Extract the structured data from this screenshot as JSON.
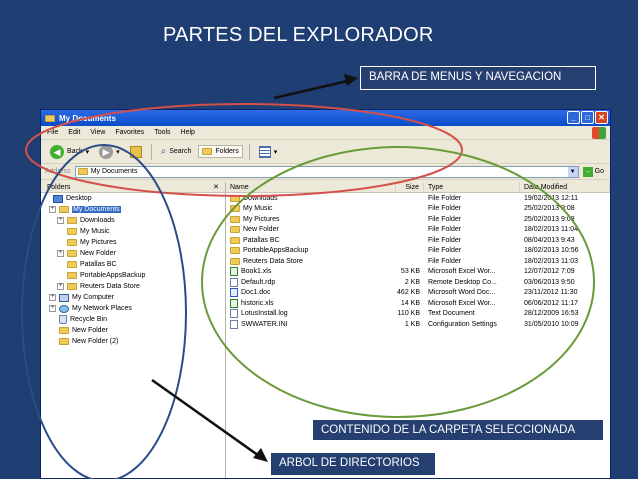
{
  "slide": {
    "title": "PARTES DEL EXPLORADOR",
    "callouts": {
      "menus": "BARRA DE MENUS Y NAVEGACION",
      "content": "CONTENIDO DE LA CARPETA SELECCIONADA",
      "tree": "ARBOL DE DIRECTORIOS"
    }
  },
  "window": {
    "title": "My Documents",
    "menu": [
      "File",
      "Edit",
      "View",
      "Favorites",
      "Tools",
      "Help"
    ],
    "toolbar": {
      "back": "Back",
      "search": "Search",
      "folders": "Folders"
    },
    "address": {
      "label": "Address",
      "value": "My Documents",
      "go": "Go"
    }
  },
  "tree": {
    "header": "Folders",
    "close": "✕",
    "items": [
      {
        "label": "Desktop",
        "icon": "desktop-icon"
      },
      {
        "label": "My Documents",
        "icon": "folder-icon"
      },
      {
        "label": "Downloads",
        "icon": "folder-icon"
      },
      {
        "label": "My Music",
        "icon": "folder-icon"
      },
      {
        "label": "My Pictures",
        "icon": "folder-icon"
      },
      {
        "label": "New Folder",
        "icon": "folder-icon"
      },
      {
        "label": "Patallas BC",
        "icon": "folder-icon"
      },
      {
        "label": "PortableAppsBackup",
        "icon": "folder-icon"
      },
      {
        "label": "Reuters Data Store",
        "icon": "folder-icon"
      },
      {
        "label": "My Computer",
        "icon": "computer-icon"
      },
      {
        "label": "My Network Places",
        "icon": "network-icon"
      },
      {
        "label": "Recycle Bin",
        "icon": "recycle-bin-icon"
      },
      {
        "label": "New Folder",
        "icon": "folder-icon"
      },
      {
        "label": "New Folder (2)",
        "icon": "folder-icon"
      }
    ]
  },
  "files": {
    "columns": {
      "name": "Name",
      "size": "Size",
      "type": "Type",
      "date": "Date Modified"
    },
    "rows": [
      {
        "name": "Downloads",
        "size": "",
        "type": "File Folder",
        "date": "19/02/2013 12:11",
        "icon": "folder"
      },
      {
        "name": "My Music",
        "size": "",
        "type": "File Folder",
        "date": "25/02/2013 9:08",
        "icon": "folder"
      },
      {
        "name": "My Pictures",
        "size": "",
        "type": "File Folder",
        "date": "25/02/2013 9:08",
        "icon": "folder"
      },
      {
        "name": "New Folder",
        "size": "",
        "type": "File Folder",
        "date": "18/02/2013 11:04",
        "icon": "folder"
      },
      {
        "name": "Patallas BC",
        "size": "",
        "type": "File Folder",
        "date": "08/04/2013 9:43",
        "icon": "folder"
      },
      {
        "name": "PortableAppsBackup",
        "size": "",
        "type": "File Folder",
        "date": "18/02/2013 10:56",
        "icon": "folder"
      },
      {
        "name": "Reuters Data Store",
        "size": "",
        "type": "File Folder",
        "date": "18/02/2013 11:03",
        "icon": "folder"
      },
      {
        "name": "Book1.xls",
        "size": "53 KB",
        "type": "Microsoft Excel Wor...",
        "date": "12/07/2012 7:09",
        "icon": "xls"
      },
      {
        "name": "Default.rdp",
        "size": "2 KB",
        "type": "Remote Desktop Co...",
        "date": "03/06/2013 9:50",
        "icon": "file"
      },
      {
        "name": "Doc1.doc",
        "size": "462 KB",
        "type": "Microsoft Word Doc...",
        "date": "23/11/2012 11:30",
        "icon": "doc"
      },
      {
        "name": "historic.xls",
        "size": "14 KB",
        "type": "Microsoft Excel Wor...",
        "date": "06/06/2012 11:17",
        "icon": "xls"
      },
      {
        "name": "LotusInstall.log",
        "size": "110 KB",
        "type": "Text Document",
        "date": "28/12/2009 16:53",
        "icon": "file"
      },
      {
        "name": "SWWATER.INI",
        "size": "1 KB",
        "type": "Configuration Settings",
        "date": "31/05/2010 10:09",
        "icon": "file"
      }
    ]
  },
  "colors": {
    "background": "#1F3E73",
    "ellipse_menu": "#D4504A",
    "ellipse_content": "#6B9A3A",
    "ellipse_tree": "#2A4D86",
    "arrow": "#111111"
  }
}
